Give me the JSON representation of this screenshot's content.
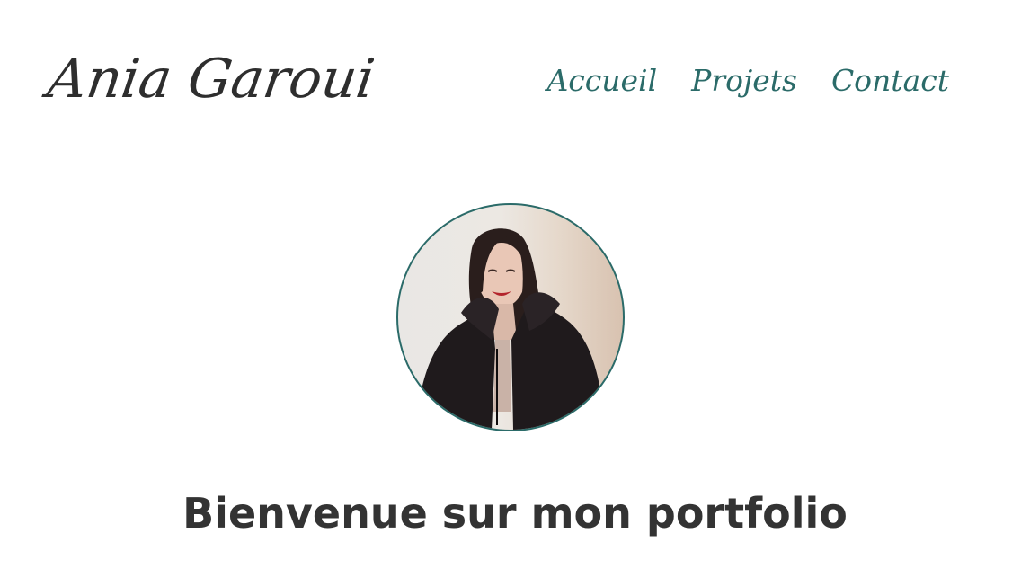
{
  "header": {
    "logo_text": "Ania Garoui"
  },
  "nav": {
    "items": [
      {
        "label": "Accueil"
      },
      {
        "label": "Projets"
      },
      {
        "label": "Contact"
      }
    ]
  },
  "hero": {
    "heading": "Bienvenue sur mon portfolio"
  },
  "colors": {
    "accent": "#2b6b69",
    "text_dark": "#333333",
    "background": "#ffffff"
  }
}
